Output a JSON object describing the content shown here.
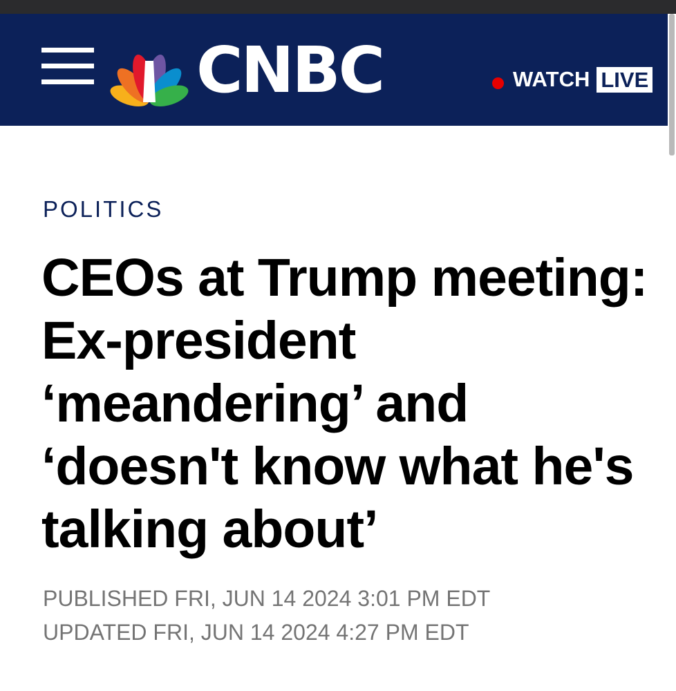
{
  "header": {
    "brand": "CNBC",
    "watch_label": "WATCH",
    "live_label": "LIVE",
    "colors": {
      "background": "#0c2159",
      "live_dot": "#e60000",
      "peacock": [
        "#f7b01b",
        "#ee7123",
        "#e1192c",
        "#6e55a3",
        "#0a8ece",
        "#36b04a"
      ]
    }
  },
  "article": {
    "category": "POLITICS",
    "headline": "CEOs at Trump meeting: Ex-president ‘meandering’ and ‘doesn't know what he's talking about’",
    "published": "PUBLISHED FRI, JUN 14 2024 3:01 PM EDT",
    "updated": "UPDATED FRI, JUN 14 2024 4:27 PM EDT"
  },
  "icons": {
    "menu": "hamburger-menu-icon",
    "logo": "nbc-peacock-logo",
    "live_indicator": "red-dot-icon"
  }
}
